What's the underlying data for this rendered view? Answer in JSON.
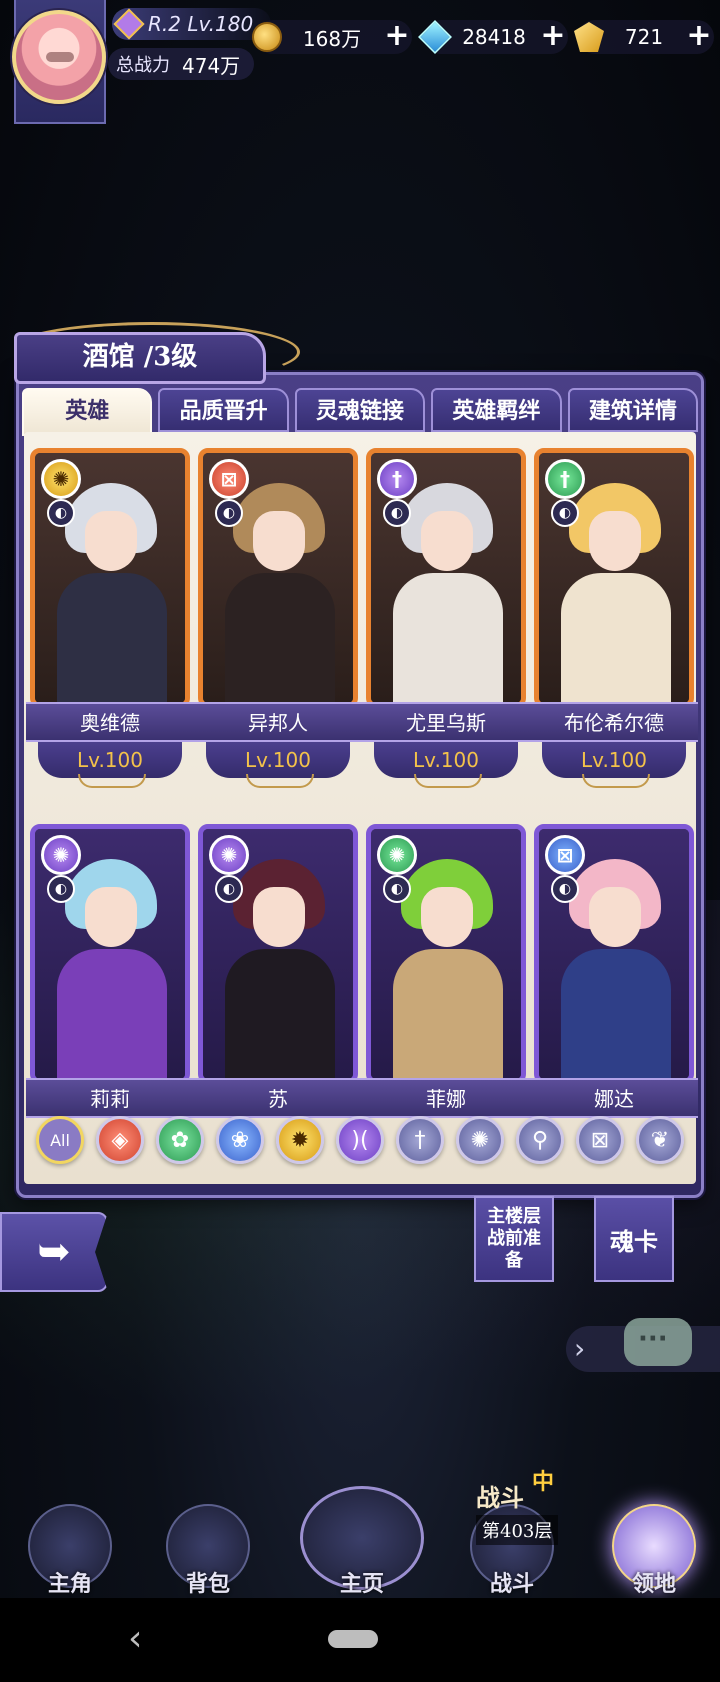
{
  "player": {
    "rank": "R.2 Lv.180",
    "power_label": "总战力",
    "power_value": "474万",
    "avatar_icon": "player-avatar"
  },
  "currencies": [
    {
      "name": "gold",
      "icon": "gold-coin-icon",
      "value": "168万"
    },
    {
      "name": "diamond",
      "icon": "diamond-icon",
      "value": "28418"
    },
    {
      "name": "crystal",
      "icon": "crystal-icon",
      "value": "721"
    }
  ],
  "panel": {
    "title": "酒馆 /3级",
    "tabs": [
      "英雄",
      "品质晋升",
      "灵魂链接",
      "英雄羁绊",
      "建筑详情"
    ],
    "active_tab": "英雄"
  },
  "heroes": [
    {
      "name": "奥维德",
      "level": "Lv.100",
      "rarity": "orange",
      "badge": "gold",
      "badge_glyph": "✺",
      "sub_glyph": "◐",
      "hair": "#d9dde6",
      "body": "#2e2f44"
    },
    {
      "name": "异邦人",
      "level": "Lv.100",
      "rarity": "orange",
      "badge": "red",
      "badge_glyph": "⊠",
      "sub_glyph": "◐",
      "hair": "#b08a5a",
      "body": "#2c2222"
    },
    {
      "name": "尤里乌斯",
      "level": "Lv.100",
      "rarity": "orange",
      "badge": "violet",
      "badge_glyph": "†",
      "sub_glyph": "◐",
      "hair": "#d8d8de",
      "body": "#e9e3dc"
    },
    {
      "name": "布伦希尔德",
      "level": "Lv.100",
      "rarity": "orange",
      "badge": "green",
      "badge_glyph": "†",
      "sub_glyph": "◐",
      "hair": "#f2c766",
      "body": "#efe3cf"
    },
    {
      "name": "莉莉",
      "level": "",
      "rarity": "purple",
      "badge": "violet",
      "badge_glyph": "✺",
      "sub_glyph": "◐",
      "hair": "#9fd6ec",
      "body": "#7a3fb8"
    },
    {
      "name": "苏",
      "level": "",
      "rarity": "purple",
      "badge": "violet",
      "badge_glyph": "✺",
      "sub_glyph": "◐",
      "hair": "#5b2232",
      "body": "#1f1a22"
    },
    {
      "name": "菲娜",
      "level": "",
      "rarity": "purple",
      "badge": "green",
      "badge_glyph": "✺",
      "sub_glyph": "◐",
      "hair": "#7fcf3a",
      "body": "#c9a878"
    },
    {
      "name": "娜达",
      "level": "",
      "rarity": "purple",
      "badge": "blue",
      "badge_glyph": "⊠",
      "sub_glyph": "◐",
      "hair": "#f3b7c8",
      "body": "#2f3f88"
    }
  ],
  "filters": [
    {
      "label": "All",
      "style": "all",
      "icon": "all-filter"
    },
    {
      "label": "◈",
      "style": "f-red",
      "icon": "fire-element-icon"
    },
    {
      "label": "✿",
      "style": "f-green",
      "icon": "wind-element-icon"
    },
    {
      "label": "❀",
      "style": "f-blue",
      "icon": "water-element-icon"
    },
    {
      "label": "✹",
      "style": "f-gold",
      "icon": "light-element-icon"
    },
    {
      "label": ")(",
      "style": "f-purple",
      "icon": "dark-element-icon"
    },
    {
      "label": "†",
      "style": "f-slate",
      "icon": "sword-class-icon"
    },
    {
      "label": "✺",
      "style": "f-slate",
      "icon": "shuriken-class-icon"
    },
    {
      "label": "⚲",
      "style": "f-slate",
      "icon": "staff-class-icon"
    },
    {
      "label": "⊠",
      "style": "f-slate",
      "icon": "shield-class-icon"
    },
    {
      "label": "❦",
      "style": "f-slate",
      "icon": "wing-class-icon"
    }
  ],
  "side_buttons": {
    "prep": "主楼层战前准备",
    "soul_card": "魂卡"
  },
  "battle_status": {
    "title": "战斗",
    "tag": "中",
    "floor": "第403层"
  },
  "nav": [
    {
      "label": "主角",
      "icon": "hero-nav-icon"
    },
    {
      "label": "背包",
      "icon": "backpack-nav-icon"
    },
    {
      "label": "主页",
      "icon": "home-book-nav-icon"
    },
    {
      "label": "战斗",
      "icon": "battle-nav-icon"
    },
    {
      "label": "领地",
      "icon": "territory-nav-icon"
    }
  ]
}
